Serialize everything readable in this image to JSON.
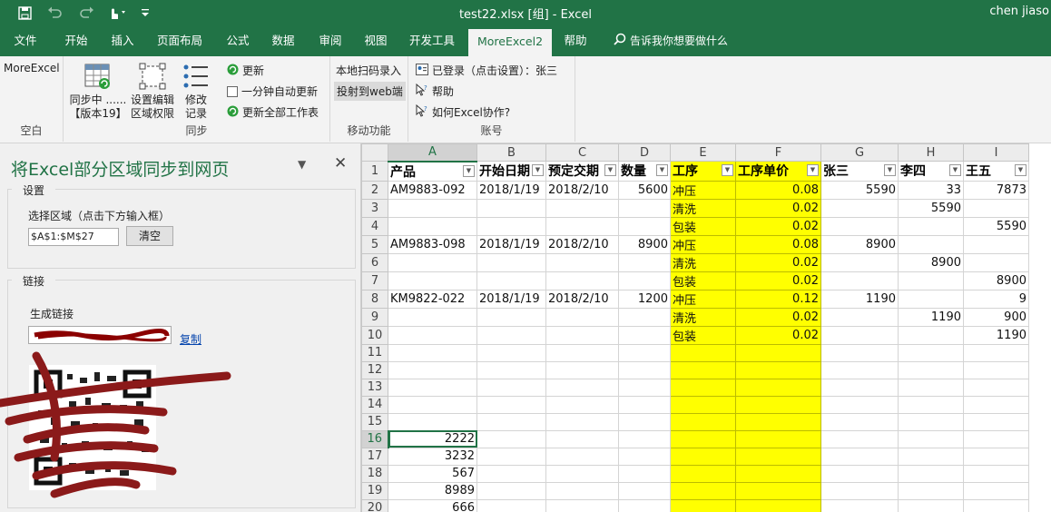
{
  "titlebar": {
    "title": "test22.xlsx  [组]  -  Excel",
    "user": "chen jiaso"
  },
  "tabs": [
    {
      "label": "文件"
    },
    {
      "label": "开始"
    },
    {
      "label": "插入"
    },
    {
      "label": "页面布局"
    },
    {
      "label": "公式"
    },
    {
      "label": "数据"
    },
    {
      "label": "审阅"
    },
    {
      "label": "视图"
    },
    {
      "label": "开发工具"
    },
    {
      "label": "MoreExcel2",
      "active": true
    },
    {
      "label": "帮助"
    }
  ],
  "tellme": "告诉我你想要做什么",
  "ribbon": {
    "blank_group": {
      "button": "MoreExcel",
      "label": "空白"
    },
    "sync_group": {
      "label": "同步",
      "sync_btn_line1": "同步中 ......",
      "sync_btn_line2": "【版本19】",
      "edit_btn_line1": "设置编辑",
      "edit_btn_line2": "区域权限",
      "modify_btn_line1": "修改",
      "modify_btn_line2": "记录",
      "refresh": "更新",
      "auto_refresh": "一分钟自动更新",
      "refresh_all": "更新全部工作表"
    },
    "mobile_group": {
      "label": "移动功能",
      "scan": "本地扫码录入",
      "project": "投射到web端"
    },
    "account_group": {
      "label": "账号",
      "logged_in": "已登录（点击设置）：张三",
      "help": "帮助",
      "cooperate": "如何Excel协作?"
    }
  },
  "pane": {
    "title": "将Excel部分区域同步到网页",
    "settings_legend": "设置",
    "select_range_label": "选择区域（点击下方输入框）",
    "range_value": "$A$1:$M$27",
    "clear_button": "清空",
    "link_legend": "链接",
    "gen_link_label": "生成链接",
    "copy_link": "复制"
  },
  "sheet": {
    "columns": [
      "A",
      "B",
      "C",
      "D",
      "E",
      "F",
      "G",
      "H",
      "I"
    ],
    "selected_column": "A",
    "selected_row": 16,
    "headers": [
      "产品",
      "开始日期",
      "预定交期",
      "数量",
      "工序",
      "工序单价",
      "张三",
      "李四",
      "王五"
    ],
    "rows": [
      [
        "AM9883-092",
        "2018/1/19",
        "2018/2/10",
        "5600",
        "冲压",
        "0.08",
        "5590",
        "33",
        "7873"
      ],
      [
        "",
        "",
        "",
        "",
        "清洗",
        "0.02",
        "",
        "5590",
        ""
      ],
      [
        "",
        "",
        "",
        "",
        "包装",
        "0.02",
        "",
        "",
        "5590"
      ],
      [
        "AM9883-098",
        "2018/1/19",
        "2018/2/10",
        "8900",
        "冲压",
        "0.08",
        "8900",
        "",
        ""
      ],
      [
        "",
        "",
        "",
        "",
        "清洗",
        "0.02",
        "",
        "8900",
        ""
      ],
      [
        "",
        "",
        "",
        "",
        "包装",
        "0.02",
        "",
        "",
        "8900"
      ],
      [
        "KM9822-022",
        "2018/1/19",
        "2018/2/10",
        "1200",
        "冲压",
        "0.12",
        "1190",
        "",
        "9"
      ],
      [
        "",
        "",
        "",
        "",
        "清洗",
        "0.02",
        "",
        "1190",
        "900"
      ],
      [
        "",
        "",
        "",
        "",
        "包装",
        "0.02",
        "",
        "",
        "1190"
      ],
      [
        "",
        "",
        "",
        "",
        "",
        "",
        "",
        "",
        ""
      ],
      [
        "",
        "",
        "",
        "",
        "",
        "",
        "",
        "",
        ""
      ],
      [
        "",
        "",
        "",
        "",
        "",
        "",
        "",
        "",
        ""
      ],
      [
        "",
        "",
        "",
        "",
        "",
        "",
        "",
        "",
        ""
      ],
      [
        "",
        "",
        "",
        "",
        "",
        "",
        "",
        "",
        ""
      ],
      [
        "2222",
        "",
        "",
        "",
        "",
        "",
        "",
        "",
        ""
      ],
      [
        "3232",
        "",
        "",
        "",
        "",
        "",
        "",
        "",
        ""
      ],
      [
        "567",
        "",
        "",
        "",
        "",
        "",
        "",
        "",
        ""
      ],
      [
        "8989",
        "",
        "",
        "",
        "",
        "",
        "",
        "",
        ""
      ],
      [
        "666",
        "",
        "",
        "",
        "",
        "",
        "",
        "",
        ""
      ]
    ],
    "row_numbers": [
      "1",
      "2",
      "3",
      "4",
      "5",
      "6",
      "7",
      "8",
      "9",
      "10",
      "11",
      "12",
      "13",
      "14",
      "15",
      "16",
      "17",
      "18",
      "19",
      "20"
    ]
  },
  "colors": {
    "excel_green": "#217346",
    "highlight_yellow": "#ffff00",
    "link_blue": "#0645ad"
  }
}
